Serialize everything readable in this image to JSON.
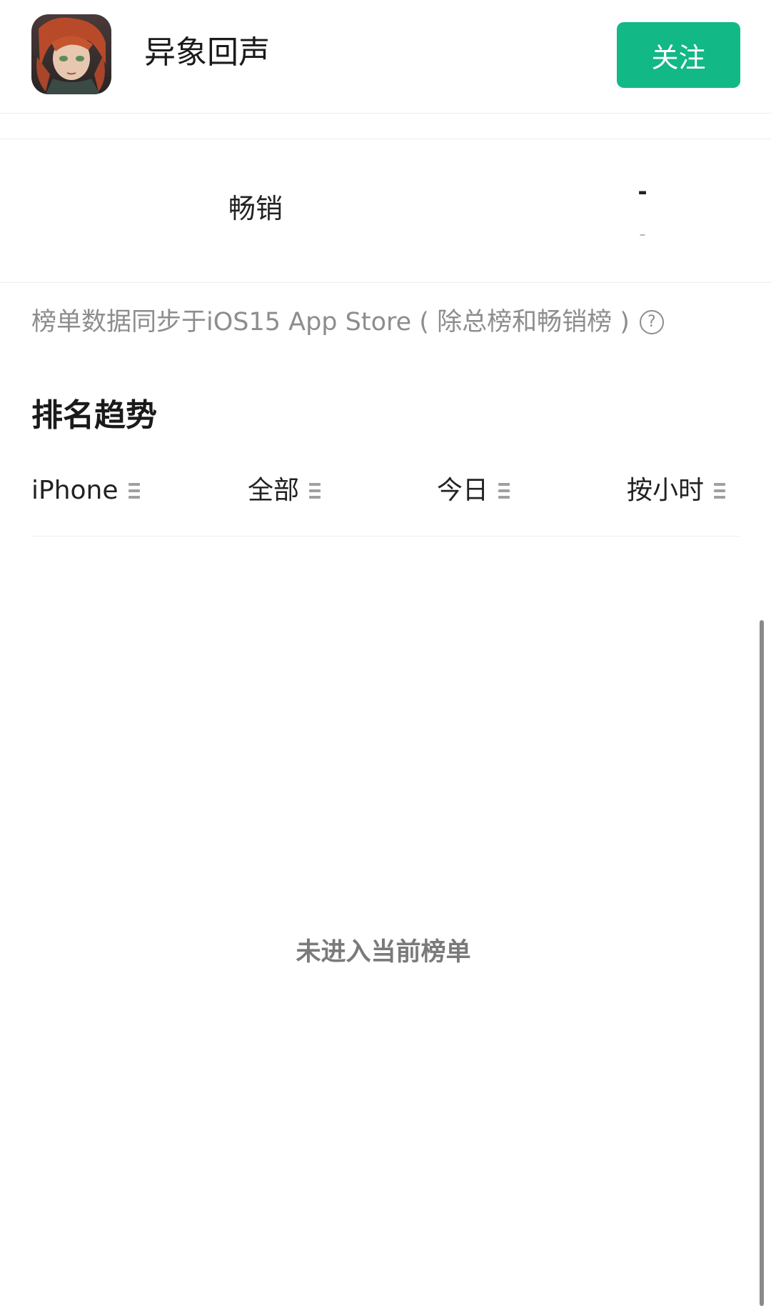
{
  "header": {
    "app_name": "异象回声",
    "follow_label": "关注",
    "accent_color": "#12b886"
  },
  "rank": {
    "label": "畅销",
    "value": "-",
    "change": "-"
  },
  "note": {
    "text": "榜单数据同步于iOS15 App Store ( 除总榜和畅销榜 )",
    "help_icon": "question-circle-icon",
    "help_glyph": "?"
  },
  "trend": {
    "title": "排名趋势",
    "filters": [
      {
        "label": "iPhone",
        "icon": "menu-icon"
      },
      {
        "label": "全部",
        "icon": "menu-icon"
      },
      {
        "label": "今日",
        "icon": "menu-icon"
      },
      {
        "label": "按小时",
        "icon": "menu-icon"
      }
    ],
    "empty_message": "未进入当前榜单"
  }
}
